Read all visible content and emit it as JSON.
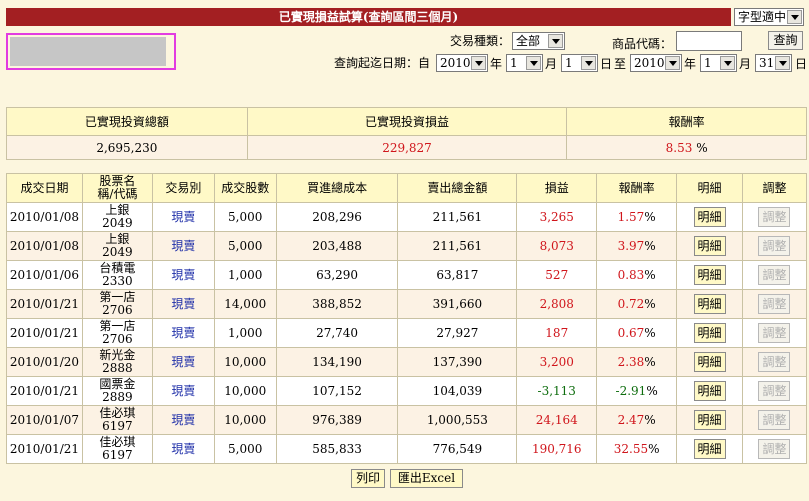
{
  "header": {
    "title": "已實現損益試算(查詢區間三個月)",
    "font_size_select": "字型適中"
  },
  "filters": {
    "trade_type_label": "交易種類：",
    "trade_type_value": "全部",
    "product_code_label": "商品代碼：",
    "product_code_value": "",
    "query_button": "查詢",
    "date_range_label": "查詢起迄日期：自",
    "start_year": "2010",
    "start_month": "1",
    "start_day": "1",
    "end_year": "2010",
    "end_month": "1",
    "end_day": "31",
    "year_unit": "年",
    "month_unit": "月",
    "day_unit": "日",
    "to_label": "至"
  },
  "summary": {
    "headers": [
      "已實現投資總額",
      "已實現投資損益",
      "報酬率"
    ],
    "total": "2,695,230",
    "pnl": "229,827",
    "rate": "8.53",
    "rate_unit": "%"
  },
  "table": {
    "headers": [
      "成交日期",
      "股票名稱/代碼",
      "交易別",
      "成交股數",
      "買進總成本",
      "賣出總金額",
      "損益",
      "報酬率",
      "明細",
      "調整"
    ],
    "detail_label": "明細",
    "adjust_label": "調整",
    "rows": [
      {
        "date": "2010/01/08",
        "name": "上銀",
        "code": "2049",
        "type": "現賣",
        "shares": "5,000",
        "cost": "208,296",
        "sell": "211,561",
        "pnl": "3,265",
        "rate": "1.57",
        "neg": false
      },
      {
        "date": "2010/01/08",
        "name": "上銀",
        "code": "2049",
        "type": "現賣",
        "shares": "5,000",
        "cost": "203,488",
        "sell": "211,561",
        "pnl": "8,073",
        "rate": "3.97",
        "neg": false
      },
      {
        "date": "2010/01/06",
        "name": "台積電",
        "code": "2330",
        "type": "現賣",
        "shares": "1,000",
        "cost": "63,290",
        "sell": "63,817",
        "pnl": "527",
        "rate": "0.83",
        "neg": false
      },
      {
        "date": "2010/01/21",
        "name": "第一店",
        "code": "2706",
        "type": "現賣",
        "shares": "14,000",
        "cost": "388,852",
        "sell": "391,660",
        "pnl": "2,808",
        "rate": "0.72",
        "neg": false
      },
      {
        "date": "2010/01/21",
        "name": "第一店",
        "code": "2706",
        "type": "現賣",
        "shares": "1,000",
        "cost": "27,740",
        "sell": "27,927",
        "pnl": "187",
        "rate": "0.67",
        "neg": false
      },
      {
        "date": "2010/01/20",
        "name": "新光金",
        "code": "2888",
        "type": "現賣",
        "shares": "10,000",
        "cost": "134,190",
        "sell": "137,390",
        "pnl": "3,200",
        "rate": "2.38",
        "neg": false
      },
      {
        "date": "2010/01/21",
        "name": "國票金",
        "code": "2889",
        "type": "現賣",
        "shares": "10,000",
        "cost": "107,152",
        "sell": "104,039",
        "pnl": "-3,113",
        "rate": "-2.91",
        "neg": true
      },
      {
        "date": "2010/01/07",
        "name": "佳必琪",
        "code": "6197",
        "type": "現賣",
        "shares": "10,000",
        "cost": "976,389",
        "sell": "1,000,553",
        "pnl": "24,164",
        "rate": "2.47",
        "neg": false
      },
      {
        "date": "2010/01/21",
        "name": "佳必琪",
        "code": "6197",
        "type": "現賣",
        "shares": "5,000",
        "cost": "585,833",
        "sell": "776,549",
        "pnl": "190,716",
        "rate": "32.55",
        "neg": false
      }
    ]
  },
  "footer": {
    "print_button": "列印",
    "export_button": "匯出Excel"
  },
  "colors": {
    "title_bar": "#a31f22",
    "page_bg": "#fcf6de",
    "header_bg": "#fff9c7",
    "profit": "#d0151b",
    "loss": "#0e6d0e",
    "type_link": "#1f2fa8"
  }
}
